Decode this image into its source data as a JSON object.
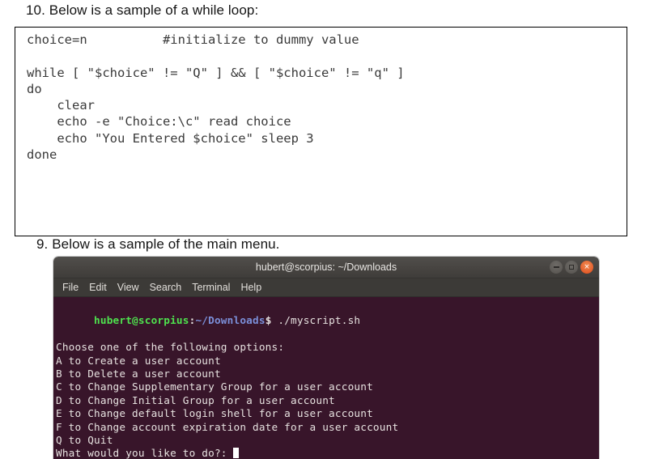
{
  "document": {
    "item_10_heading": "10. Below is a sample of a while loop:",
    "item_9_heading": "9. Below is a sample of the main menu.",
    "code_sample": "choice=n          #initialize to dummy value\n\nwhile [ \"$choice\" != \"Q\" ] && [ \"$choice\" != \"q\" ]\ndo\n    clear\n    echo -e \"Choice:\\c\" read choice\n    echo \"You Entered $choice\" sleep 3\ndone"
  },
  "terminal": {
    "title": "hubert@scorpius: ~/Downloads",
    "window_controls": {
      "minimize_label": "−",
      "maximize_label": "□",
      "close_label": "×"
    },
    "menubar": [
      {
        "label": "File"
      },
      {
        "label": "Edit"
      },
      {
        "label": "View"
      },
      {
        "label": "Search"
      },
      {
        "label": "Terminal"
      },
      {
        "label": "Help"
      }
    ],
    "prompt": {
      "user_host": "hubert@scorpius",
      "separator": ":",
      "path": "~/Downloads",
      "dollar": "$",
      "command": " ./myscript.sh"
    },
    "output_lines": [
      "Choose one of the following options:",
      "A to Create a user account",
      "B to Delete a user account",
      "C to Change Supplementary Group for a user account",
      "D to Change Initial Group for a user account",
      "E to Change default login shell for a user account",
      "F to Change account expiration date for a user account",
      "Q to Quit"
    ],
    "input_prompt": "What would you like to do?: ",
    "colors": {
      "background": "#38152a",
      "user_host": "#4ee24e",
      "path": "#7b8fd9",
      "text": "#e7e2e0",
      "titlebar": "#474441",
      "menubar": "#3c3a37",
      "close_button": "#df4a1a"
    }
  }
}
